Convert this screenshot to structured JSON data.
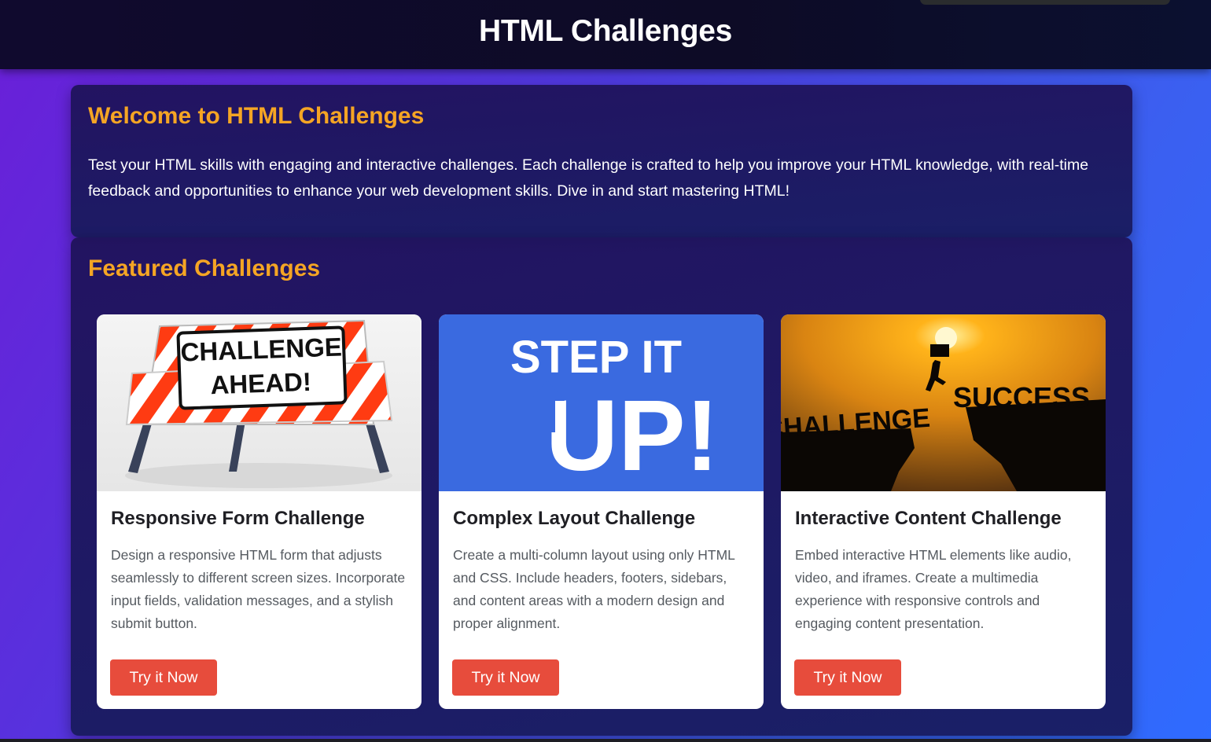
{
  "header": {
    "title": "HTML Challenges"
  },
  "welcome": {
    "title": "Welcome to HTML Challenges",
    "text": "Test your HTML skills with engaging and interactive challenges. Each challenge is crafted to help you improve your HTML knowledge, with real-time feedback and opportunities to enhance your web development skills. Dive in and start mastering HTML!"
  },
  "featured": {
    "title": "Featured Challenges",
    "cards": [
      {
        "title": "Responsive Form Challenge",
        "description": "Design a responsive HTML form that adjusts seamlessly to different screen sizes. Incorporate input fields, validation messages, and a stylish submit button.",
        "button": "Try it Now",
        "image_text": [
          "CHALLENGE",
          "AHEAD!"
        ]
      },
      {
        "title": "Complex Layout Challenge",
        "description": "Create a multi-column layout using only HTML and CSS. Include headers, footers, sidebars, and content areas with a modern design and proper alignment.",
        "button": "Try it Now",
        "image_text": [
          "STEP IT",
          "UP!"
        ]
      },
      {
        "title": "Interactive Content Challenge",
        "description": "Embed interactive HTML elements like audio, video, and iframes. Create a multimedia experience with responsive controls and engaging content presentation.",
        "button": "Try it Now",
        "image_text": [
          "CHALLENGE",
          "SUCCESS"
        ]
      }
    ]
  },
  "colors": {
    "accent": "#f5a524",
    "button": "#e74c3c"
  }
}
